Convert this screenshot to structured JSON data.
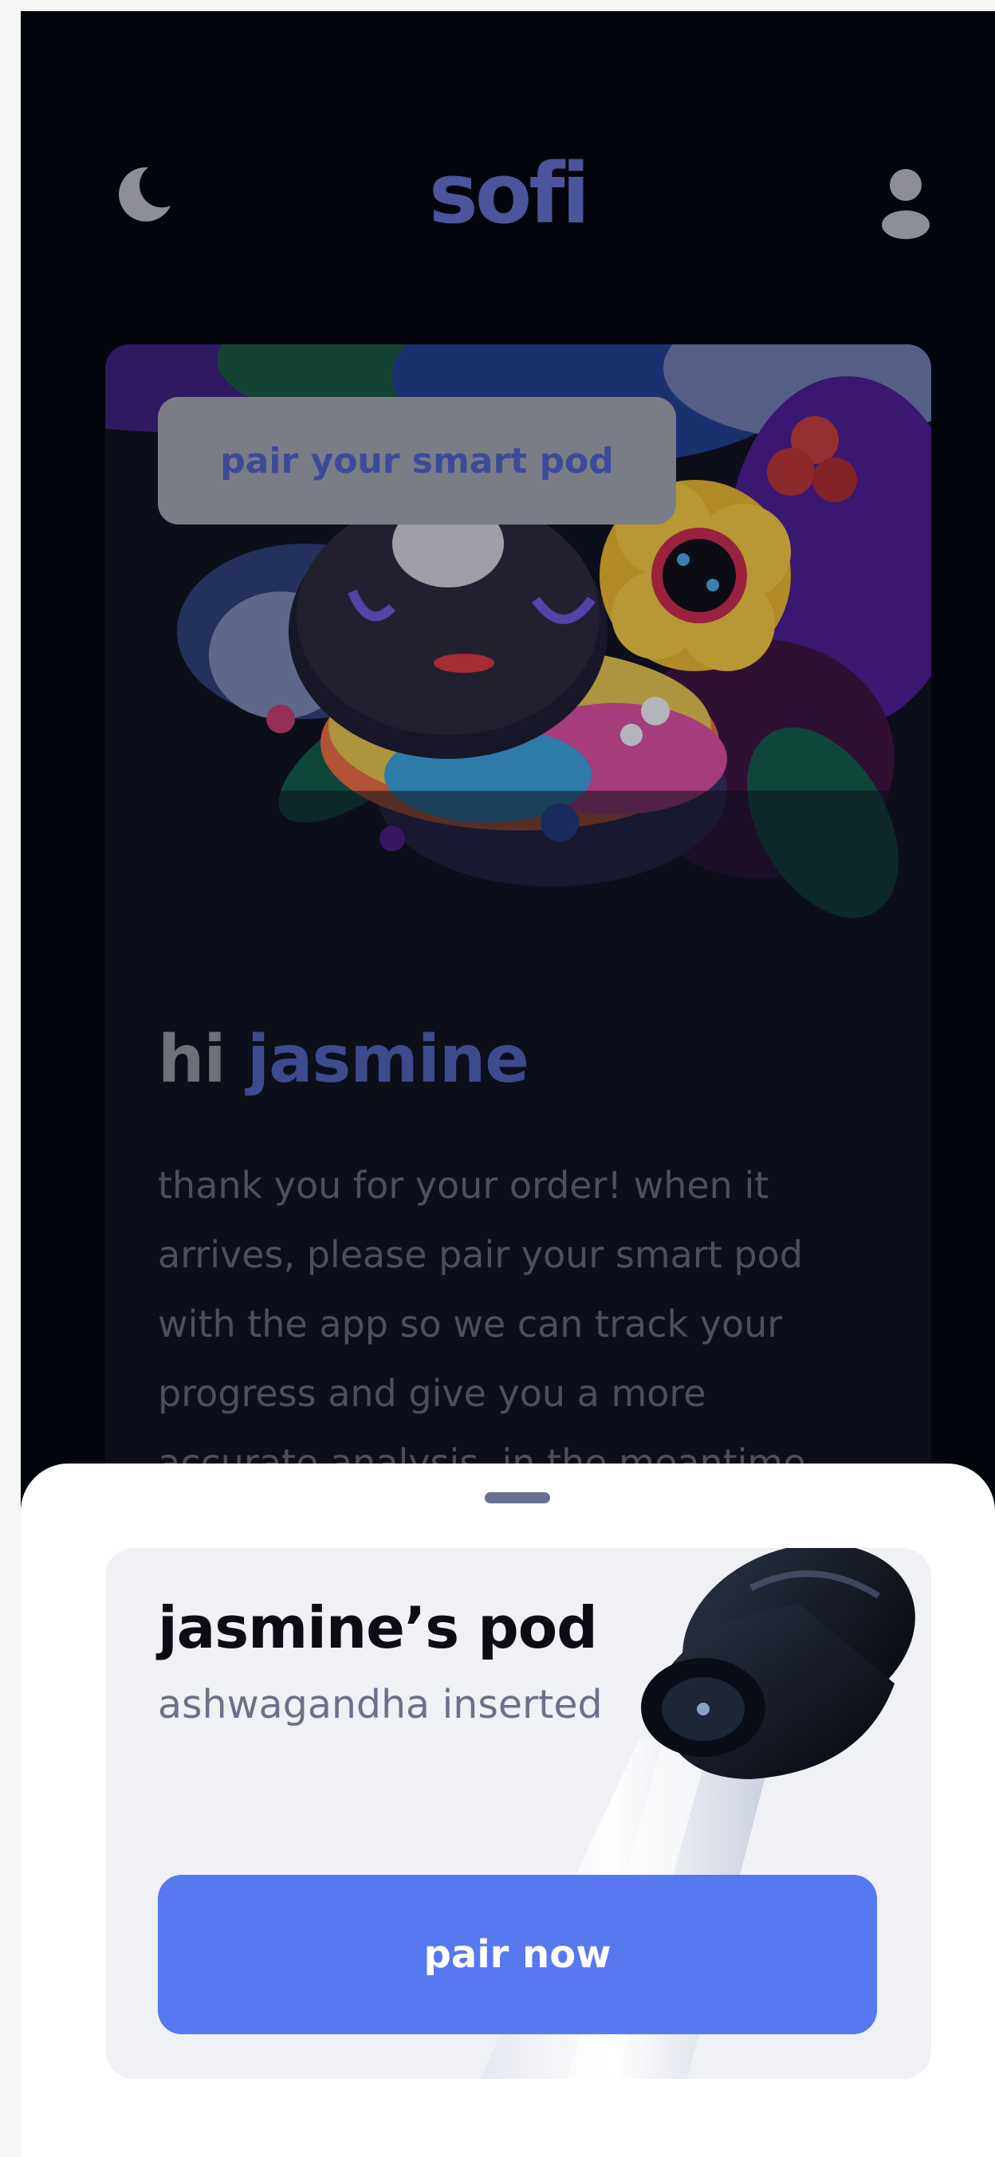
{
  "header": {
    "logo_text": "sofi",
    "moon_icon": "moon-icon",
    "profile_icon": "user-icon"
  },
  "card": {
    "chip_label": "pair your smart pod",
    "greeting_prefix": "hi",
    "greeting_name": "jasmine",
    "message": "thank you for your order! when it arrives, please pair your smart pod with the app so we can track your progress and give you a more accurate analysis. in the meantime"
  },
  "sheet": {
    "pod_title": "jasmine’s pod",
    "pod_subtitle": "ashwagandha inserted",
    "pair_button_label": "pair now"
  },
  "colors": {
    "accent": "#5778ef",
    "background": "#03050d",
    "logo": "#4b559c"
  }
}
